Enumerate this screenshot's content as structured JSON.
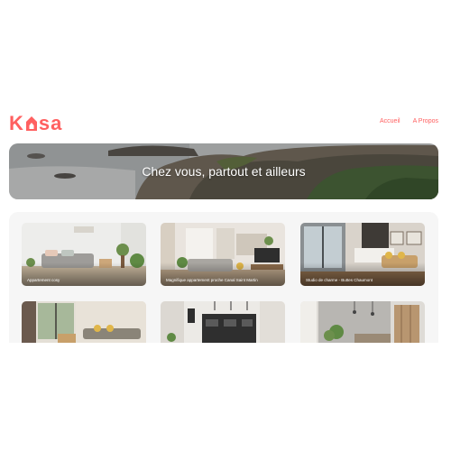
{
  "header": {
    "logo_text_1": "K",
    "logo_text_2": "sa",
    "logo_color": "#FF6060",
    "nav": [
      {
        "label": "Accueil"
      },
      {
        "label": "A Propos"
      }
    ]
  },
  "banner": {
    "title": "Chez vous, partout et ailleurs"
  },
  "gallery": {
    "cards": [
      {
        "title": "Appartement cosy"
      },
      {
        "title": "Magnifique appartement proche Canal Saint Martin"
      },
      {
        "title": "Studio de charme - Buttes Chaumont"
      },
      {
        "title": ""
      },
      {
        "title": ""
      },
      {
        "title": ""
      }
    ]
  }
}
